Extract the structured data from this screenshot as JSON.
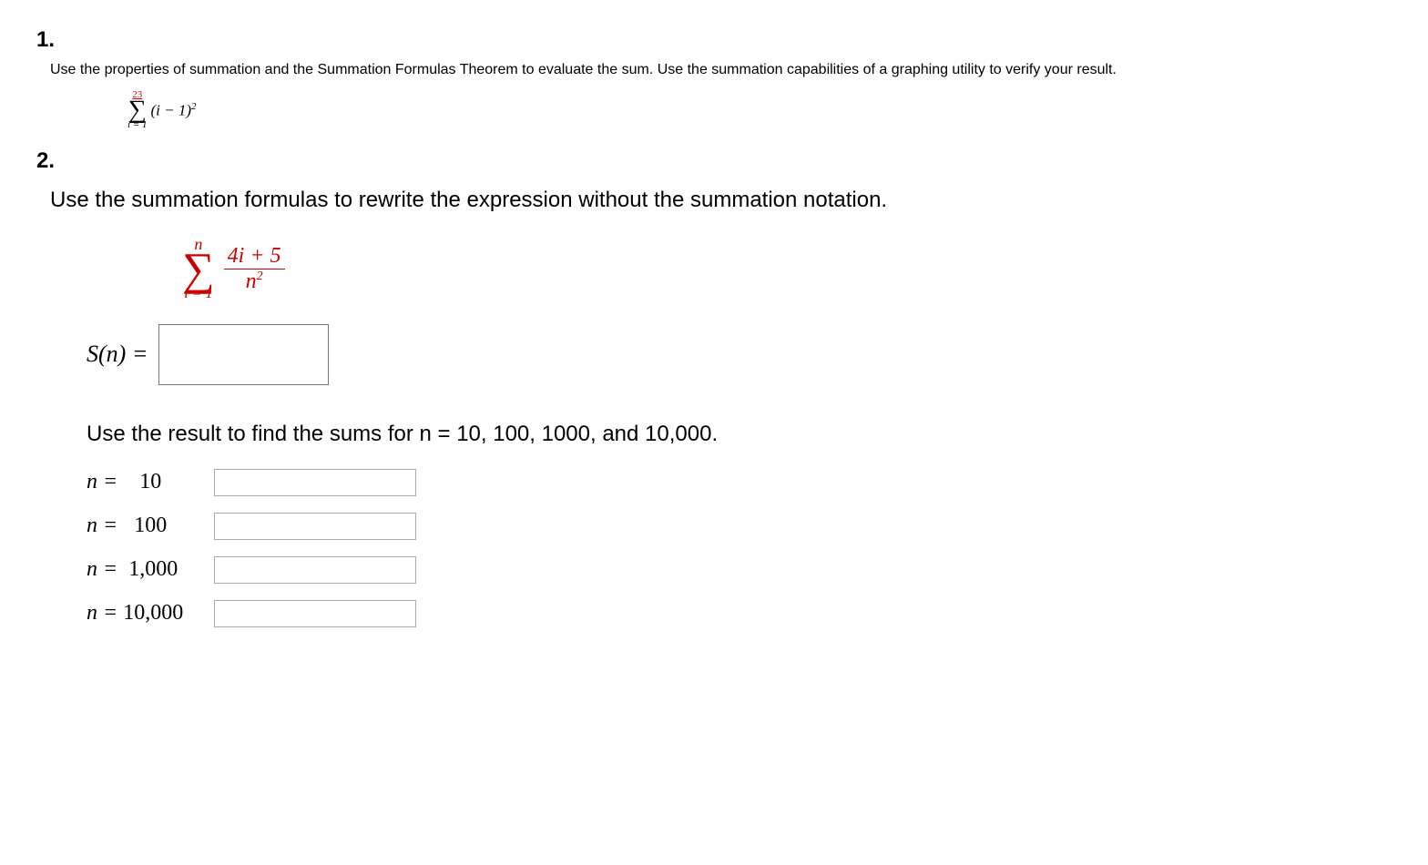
{
  "q1": {
    "number": "1.",
    "instruction": "Use the properties of summation and the Summation Formulas Theorem to evaluate the sum. Use the summation capabilities of a graphing utility to verify your result.",
    "sum": {
      "upper": "23",
      "lower": "i = 1",
      "term": "(i − 1)",
      "exp": "2"
    }
  },
  "q2": {
    "number": "2.",
    "instruction1": "Use the summation formulas to rewrite the expression without the summation notation.",
    "sum": {
      "upper": "n",
      "lower": "i = 1",
      "num": "4i + 5",
      "den_base": "n",
      "den_exp": "2"
    },
    "sn_label": "S(n) =",
    "instruction2": "Use the result to find the sums for n = 10, 100, 1000, and 10,000.",
    "rows": [
      {
        "prefix": "n =    ",
        "value": "10"
      },
      {
        "prefix": "n =   ",
        "value": "100"
      },
      {
        "prefix": "n =  ",
        "value": "1,000"
      },
      {
        "prefix": "n = ",
        "value": "10,000"
      }
    ]
  }
}
